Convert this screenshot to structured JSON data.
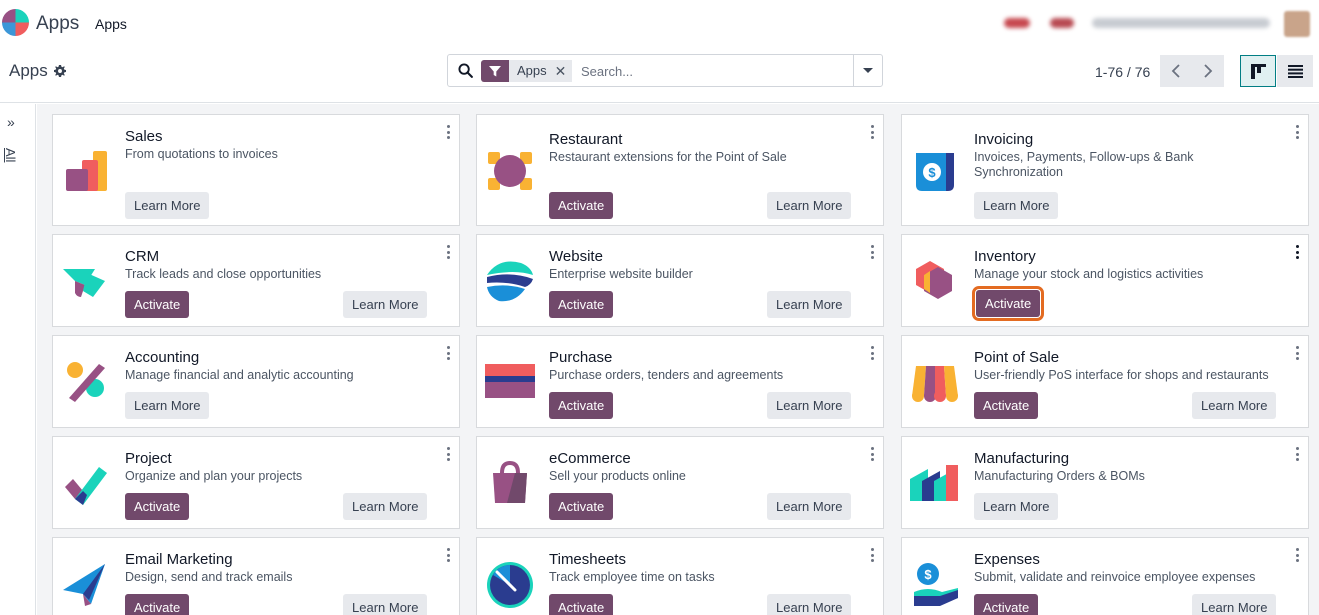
{
  "navbar": {
    "app_name": "Apps",
    "menu_item": "Apps",
    "company_blurred": "My Company (San Francisco)"
  },
  "control_panel": {
    "breadcrumb": "Apps",
    "search": {
      "facet_value": "Apps",
      "placeholder": "Search..."
    },
    "pager": "1-76 / 76"
  },
  "sidepanel": {
    "category_label": "All"
  },
  "colors": {
    "primary": "#71496b",
    "highlight": "#e36b21",
    "background": "#f3f4f6"
  },
  "apps": [
    {
      "name": "Sales",
      "summary": "From quotations to invoices",
      "activate": "",
      "learn_more": "Learn More",
      "icon": "sales-icon"
    },
    {
      "name": "Restaurant",
      "summary": "Restaurant extensions for the Point of Sale",
      "activate": "Activate",
      "learn_more": "Learn More",
      "icon": "restaurant-icon"
    },
    {
      "name": "Invoicing",
      "summary": "Invoices, Payments, Follow-ups & Bank Synchronization",
      "activate": "",
      "learn_more": "Learn More",
      "icon": "invoicing-icon"
    },
    {
      "name": "CRM",
      "summary": "Track leads and close opportunities",
      "activate": "Activate",
      "learn_more": "Learn More",
      "icon": "crm-icon"
    },
    {
      "name": "Website",
      "summary": "Enterprise website builder",
      "activate": "Activate",
      "learn_more": "Learn More",
      "icon": "website-icon"
    },
    {
      "name": "Inventory",
      "summary": "Manage your stock and logistics activities",
      "activate": "Activate",
      "learn_more": "",
      "icon": "inventory-icon"
    },
    {
      "name": "Accounting",
      "summary": "Manage financial and analytic accounting",
      "activate": "",
      "learn_more": "Learn More",
      "icon": "accounting-icon"
    },
    {
      "name": "Purchase",
      "summary": "Purchase orders, tenders and agreements",
      "activate": "Activate",
      "learn_more": "Learn More",
      "icon": "purchase-icon"
    },
    {
      "name": "Point of Sale",
      "summary": "User-friendly PoS interface for shops and restaurants",
      "activate": "Activate",
      "learn_more": "Learn More",
      "icon": "point-of-sale-icon"
    },
    {
      "name": "Project",
      "summary": "Organize and plan your projects",
      "activate": "Activate",
      "learn_more": "Learn More",
      "icon": "project-icon"
    },
    {
      "name": "eCommerce",
      "summary": "Sell your products online",
      "activate": "Activate",
      "learn_more": "Learn More",
      "icon": "ecommerce-icon"
    },
    {
      "name": "Manufacturing",
      "summary": "Manufacturing Orders & BOMs",
      "activate": "",
      "learn_more": "Learn More",
      "icon": "manufacturing-icon"
    },
    {
      "name": "Email Marketing",
      "summary": "Design, send and track emails",
      "activate": "Activate",
      "learn_more": "Learn More",
      "icon": "email-marketing-icon"
    },
    {
      "name": "Timesheets",
      "summary": "Track employee time on tasks",
      "activate": "Activate",
      "learn_more": "Learn More",
      "icon": "timesheets-icon"
    },
    {
      "name": "Expenses",
      "summary": "Submit, validate and reinvoice employee expenses",
      "activate": "Activate",
      "learn_more": "Learn More",
      "icon": "expenses-icon"
    }
  ]
}
